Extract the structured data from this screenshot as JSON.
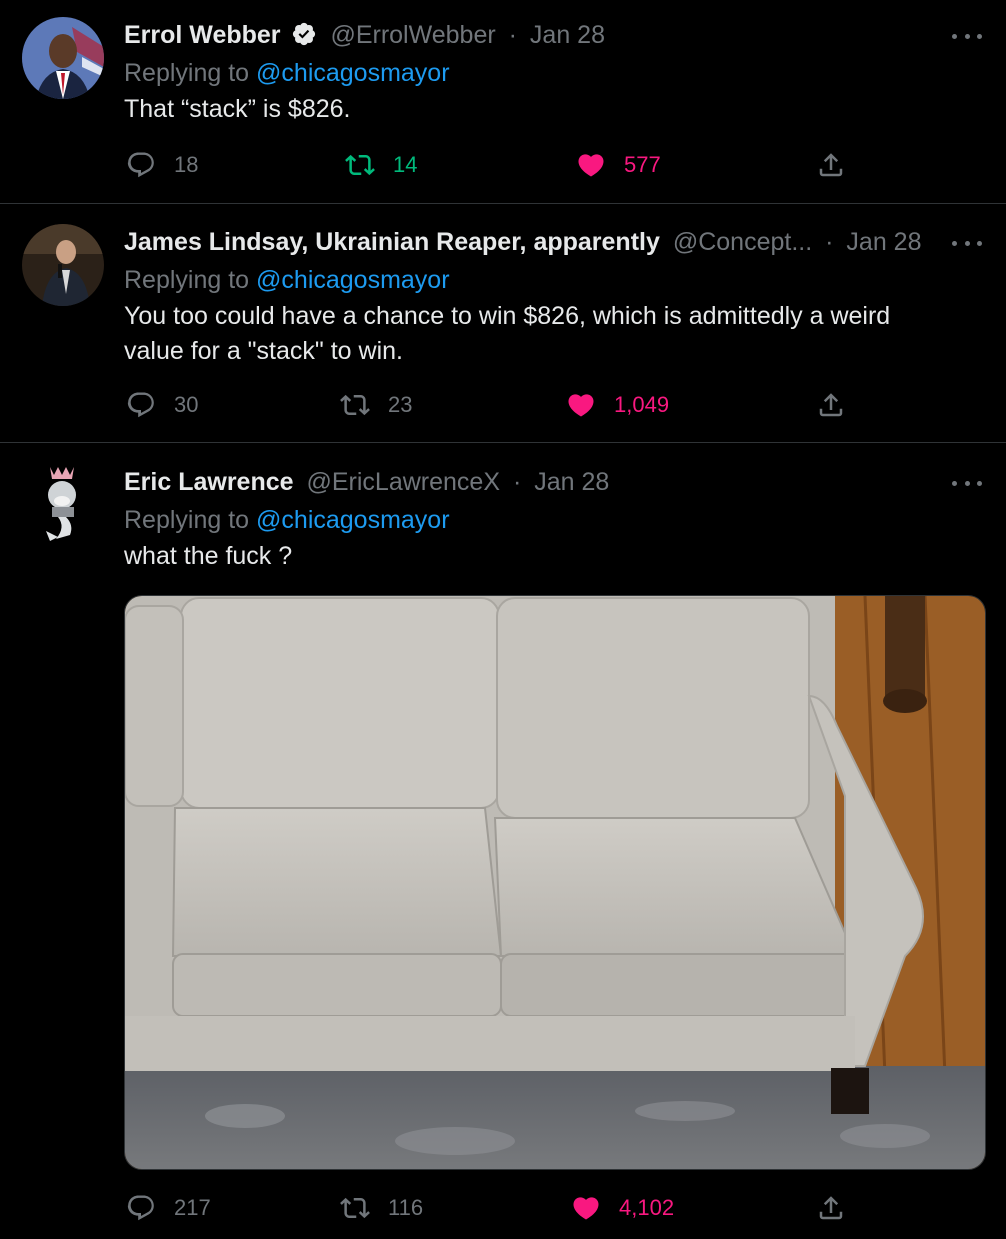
{
  "tweets": [
    {
      "name": "Errol Webber",
      "handle": "@ErrolWebber",
      "sep": "·",
      "date": "Jan 28",
      "replying_prefix": "Replying to",
      "replying_to": "@chicagosmayor",
      "text": "That “stack” is $826.",
      "replies": "18",
      "retweets": "14",
      "likes": "577",
      "retweeted": true,
      "liked": true
    },
    {
      "name": "James Lindsay, Ukrainian Reaper, apparently",
      "handle": "@Concept...",
      "sep": "·",
      "date": "Jan 28",
      "replying_prefix": "Replying to",
      "replying_to": "@chicagosmayor",
      "text_line1": "You too could have a chance to win $826, which is admittedly a weird",
      "text_line2": "value for a \"stack\" to win.",
      "replies": "30",
      "retweets": "23",
      "likes": "1,049",
      "retweeted": false,
      "liked": true
    },
    {
      "name": "Eric Lawrence",
      "handle": "@EricLawrenceX",
      "sep": "·",
      "date": "Jan 28",
      "replying_prefix": "Replying to",
      "replying_to": "@chicagosmayor",
      "text": "what the fuck ?",
      "replies": "217",
      "retweets": "116",
      "likes": "4,102",
      "retweeted": false,
      "liked": true,
      "media": "photo of a light gray couch on a wooden floor with a rug"
    }
  ],
  "colors": {
    "background": "#000000",
    "text": "#e7e9ea",
    "muted": "#71767b",
    "link": "#1d9bf0",
    "like": "#f91880",
    "retweet": "#00ba7c"
  },
  "icons": [
    "reply-icon",
    "retweet-icon",
    "like-icon",
    "share-icon",
    "more-icon",
    "verified-badge-icon"
  ]
}
